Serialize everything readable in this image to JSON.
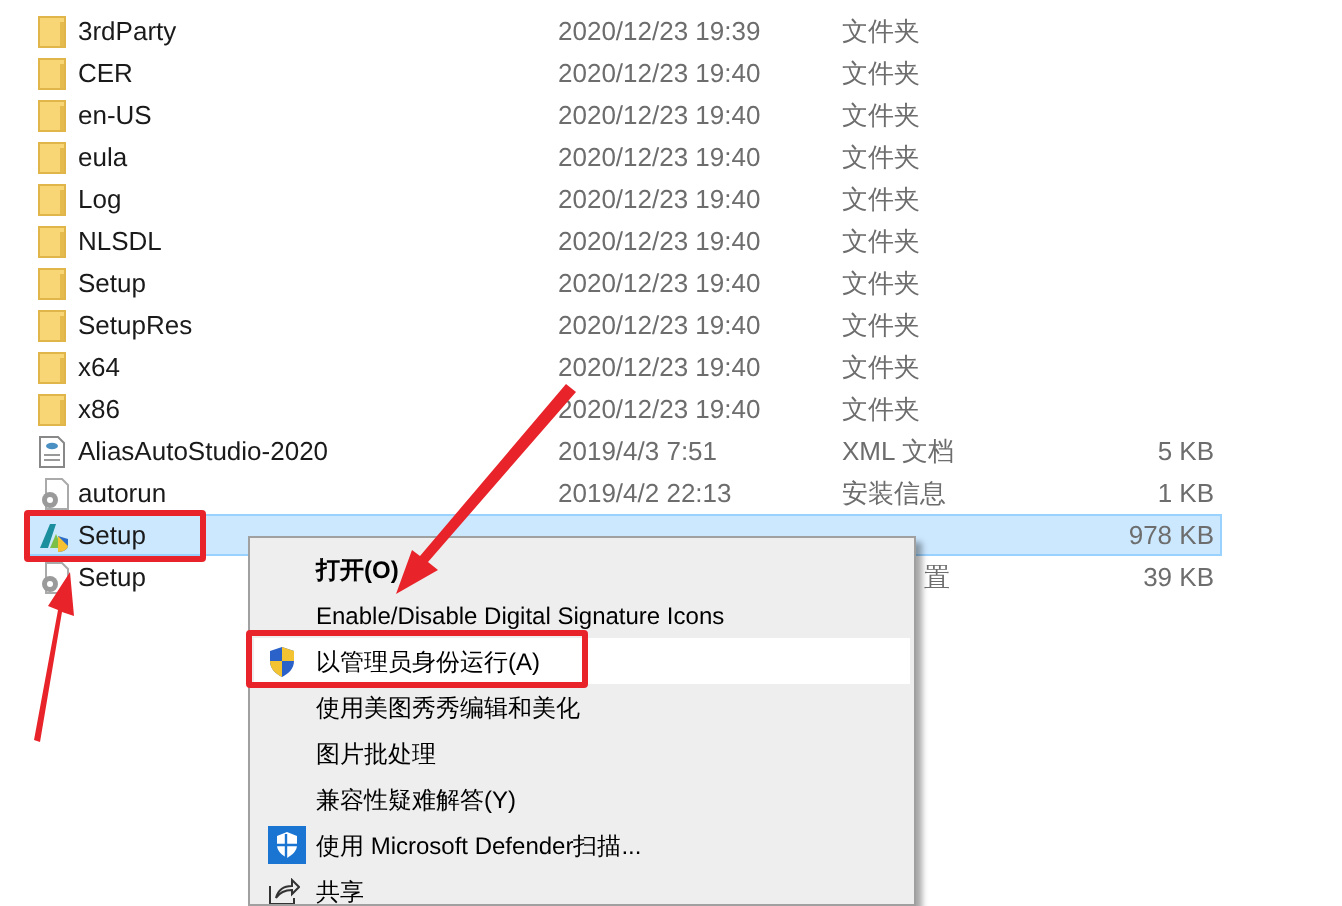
{
  "files": [
    {
      "name": "3rdParty",
      "kind": "folder",
      "date": "2020/12/23 19:39",
      "type": "文件夹",
      "selected": false
    },
    {
      "name": "CER",
      "kind": "folder",
      "date": "2020/12/23 19:40",
      "type": "文件夹",
      "selected": false
    },
    {
      "name": "en-US",
      "kind": "folder",
      "date": "2020/12/23 19:40",
      "type": "文件夹",
      "selected": false
    },
    {
      "name": "eula",
      "kind": "folder",
      "date": "2020/12/23 19:40",
      "type": "文件夹",
      "selected": false
    },
    {
      "name": "Log",
      "kind": "folder",
      "date": "2020/12/23 19:40",
      "type": "文件夹",
      "selected": false
    },
    {
      "name": "NLSDL",
      "kind": "folder",
      "date": "2020/12/23 19:40",
      "type": "文件夹",
      "selected": false
    },
    {
      "name": "Setup",
      "kind": "folder",
      "date": "2020/12/23 19:40",
      "type": "文件夹",
      "selected": false
    },
    {
      "name": "SetupRes",
      "kind": "folder",
      "date": "2020/12/23 19:40",
      "type": "文件夹",
      "selected": false
    },
    {
      "name": "x64",
      "kind": "folder",
      "date": "2020/12/23 19:40",
      "type": "文件夹",
      "selected": false
    },
    {
      "name": "x86",
      "kind": "folder",
      "date": "2020/12/23 19:40",
      "type": "文件夹",
      "selected": false
    },
    {
      "name": "AliasAutoStudio-2020",
      "kind": "xml",
      "date": "2019/4/3 7:51",
      "type": "XML 文档",
      "size": "5 KB",
      "selected": false
    },
    {
      "name": "autorun",
      "kind": "settings",
      "date": "2019/4/2 22:13",
      "type": "安装信息",
      "size": "1 KB",
      "selected": false
    },
    {
      "name": "Setup",
      "kind": "app",
      "size": "978 KB",
      "selected": true
    },
    {
      "name": "Setup",
      "kind": "settings",
      "type": "置",
      "size": "39 KB",
      "selected": false
    }
  ],
  "context_menu": {
    "items": [
      {
        "label": "打开(O)",
        "kind": "default",
        "selected": false
      },
      {
        "label": "Enable/Disable Digital Signature Icons",
        "kind": "plain",
        "selected": false
      },
      {
        "label": "以管理员身份运行(A)",
        "kind": "shield",
        "selected": true
      },
      {
        "label": "使用美图秀秀编辑和美化",
        "kind": "plain",
        "selected": false
      },
      {
        "label": "图片批处理",
        "kind": "plain",
        "selected": false
      },
      {
        "label": "兼容性疑难解答(Y)",
        "kind": "plain",
        "selected": false
      },
      {
        "label": "使用 Microsoft Defender扫描...",
        "kind": "defender",
        "selected": false
      },
      {
        "label": "共享",
        "kind": "share",
        "selected": false
      }
    ]
  }
}
